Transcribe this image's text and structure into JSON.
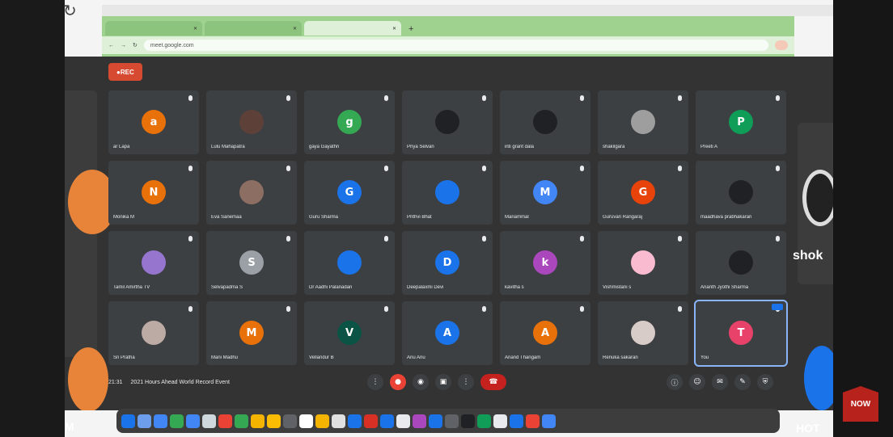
{
  "overlays": {
    "left_letter": "M",
    "right_partial": "shok",
    "bottom_right_partial": "HOT",
    "news_badge": "NOW"
  },
  "browser": {
    "tabs": [
      {
        "label": ""
      },
      {
        "label": ""
      },
      {
        "label": "",
        "active": true
      }
    ],
    "url": "meet.google.com"
  },
  "meeting": {
    "record_label": "REC",
    "time": "21:31",
    "title": "2021 Hours Ahead World Record Event",
    "participants": [
      {
        "initial": "a",
        "name": "ar Lapa",
        "color": "#e8710a"
      },
      {
        "initial": "",
        "name": "Lulu Mahapatra",
        "color": "#5d4037"
      },
      {
        "initial": "g",
        "name": "gaya Gayathri",
        "color": "#34a853"
      },
      {
        "initial": "",
        "name": "Priya Selvan",
        "color": "#202124"
      },
      {
        "initial": "",
        "name": "inti grant dala",
        "color": "#202124"
      },
      {
        "initial": "",
        "name": "shakilgara",
        "color": "#9e9e9e"
      },
      {
        "initial": "P",
        "name": "Preeti A",
        "color": "#0f9d58"
      },
      {
        "initial": "N",
        "name": "Monika M",
        "color": "#e8710a"
      },
      {
        "initial": "",
        "name": "Eva Sanemaa",
        "color": "#8d6e63"
      },
      {
        "initial": "G",
        "name": "Guru Sharma",
        "color": "#1a73e8"
      },
      {
        "initial": "",
        "name": "Prithvi Bhat",
        "color": "#1a73e8"
      },
      {
        "initial": "M",
        "name": "Mariammal",
        "color": "#4285f4"
      },
      {
        "initial": "G",
        "name": "Guruvan Rangaraj",
        "color": "#e8430a"
      },
      {
        "initial": "",
        "name": "maadhava prabhakaran",
        "color": "#202124"
      },
      {
        "initial": "",
        "name": "Tamil Amirtha TV",
        "color": "#9575cd"
      },
      {
        "initial": "S",
        "name": "Selvapadma S",
        "color": "#9aa0a6"
      },
      {
        "initial": "",
        "name": "Dr Aadhi Palanadan",
        "color": "#1a73e8"
      },
      {
        "initial": "D",
        "name": "Deepalaxmi Devi",
        "color": "#1a73e8"
      },
      {
        "initial": "k",
        "name": "kavitha s",
        "color": "#ab47bc"
      },
      {
        "initial": "",
        "name": "Vishmistani s",
        "color": "#f8bbd0"
      },
      {
        "initial": "",
        "name": "Ananth Jyothi Sharma",
        "color": "#202124"
      },
      {
        "initial": "",
        "name": "Sri Pratha",
        "color": "#bcaaa4"
      },
      {
        "initial": "M",
        "name": "Mani Madhu",
        "color": "#e8710a"
      },
      {
        "initial": "V",
        "name": "Vellandur B",
        "color": "#0b5345"
      },
      {
        "initial": "A",
        "name": "Anu Anu",
        "color": "#1a73e8"
      },
      {
        "initial": "A",
        "name": "Anand Thangam",
        "color": "#e8710a"
      },
      {
        "initial": "",
        "name": "Renuka sakaran",
        "color": "#d7ccc8"
      },
      {
        "initial": "T",
        "name": "You",
        "color": "#e8426b",
        "active": true
      }
    ]
  },
  "dock_colors": [
    "#1a73e8",
    "#6d9eeb",
    "#4285f4",
    "#34a853",
    "#4285f4",
    "#cfd8dc",
    "#ea4335",
    "#34a853",
    "#f4b400",
    "#fbbc04",
    "#5f6368",
    "#ffffff",
    "#f4b400",
    "#e0e0e0",
    "#1a73e8",
    "#d93025",
    "#1a73e8",
    "#e8eaed",
    "#ab47bc",
    "#1a73e8",
    "#5f6368",
    "#202124",
    "#0f9d58",
    "#e8eaed",
    "#1a73e8",
    "#ea4335",
    "#4285f4"
  ]
}
